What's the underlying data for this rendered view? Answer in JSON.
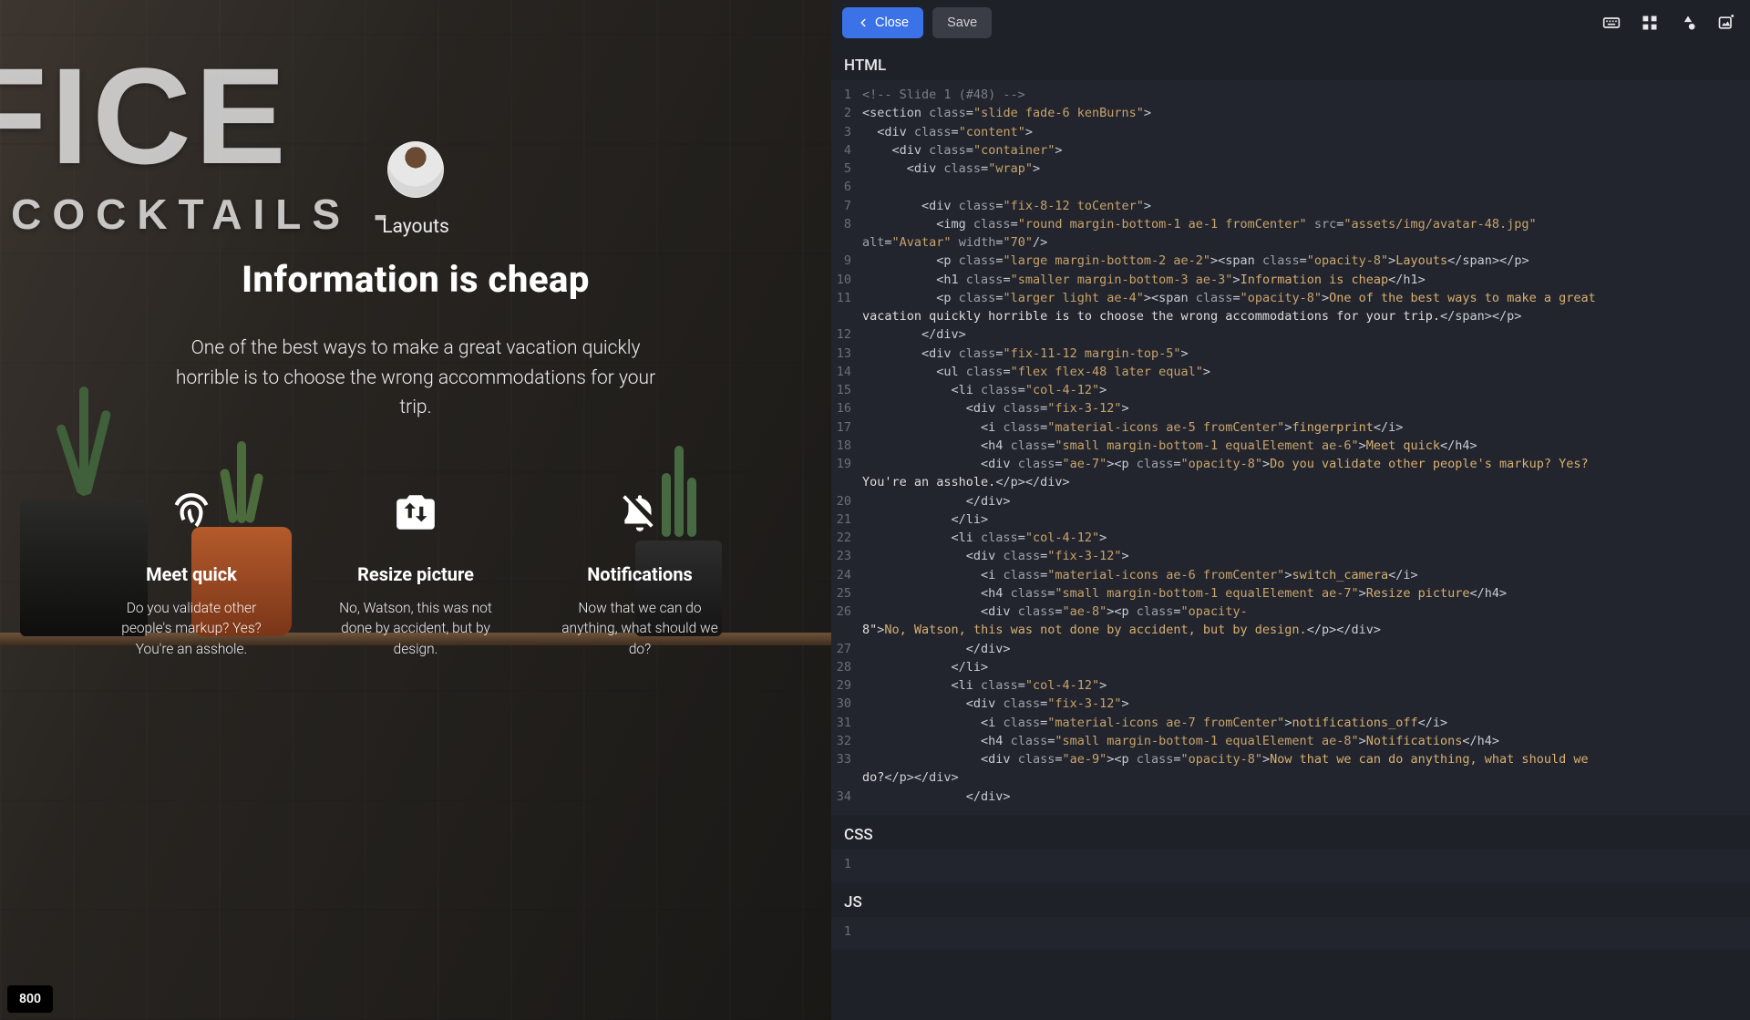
{
  "toolbar": {
    "close_label": "Close",
    "save_label": "Save"
  },
  "sections": {
    "html": "HTML",
    "css": "CSS",
    "js": "JS"
  },
  "badge": "800",
  "slide": {
    "subtitle": "Layouts",
    "title": "Information is cheap",
    "tagline": "One of the best ways to make a great vacation quickly horrible is to choose the wrong accommodations for your trip.",
    "features": [
      {
        "icon": "fingerprint",
        "heading": "Meet quick",
        "body": "Do you validate other people's markup? Yes? You're an asshole."
      },
      {
        "icon": "switch_camera",
        "heading": "Resize picture",
        "body": "No, Watson, this was not done by accident, but by design."
      },
      {
        "icon": "notifications_off",
        "heading": "Notifications",
        "body": "Now that we can do anything, what should we do?"
      }
    ]
  },
  "glass": {
    "line1": "FICE",
    "line2": "- COCKTAILS -"
  },
  "code_html": [
    {
      "n": 1,
      "seg": [
        [
          "comment",
          "<!-- Slide 1 (#48) -->"
        ]
      ]
    },
    {
      "n": 2,
      "seg": [
        [
          "tag",
          "<section "
        ],
        [
          "attr",
          "class"
        ],
        [
          "tag",
          "="
        ],
        [
          "str",
          "\"slide fade-6 kenBurns\""
        ],
        [
          "tag",
          ">"
        ]
      ]
    },
    {
      "n": 3,
      "seg": [
        [
          "tag",
          "  <div "
        ],
        [
          "attr",
          "class"
        ],
        [
          "tag",
          "="
        ],
        [
          "str",
          "\"content\""
        ],
        [
          "tag",
          ">"
        ]
      ]
    },
    {
      "n": 4,
      "seg": [
        [
          "tag",
          "    <div "
        ],
        [
          "attr",
          "class"
        ],
        [
          "tag",
          "="
        ],
        [
          "str",
          "\"container\""
        ],
        [
          "tag",
          ">"
        ]
      ]
    },
    {
      "n": 5,
      "seg": [
        [
          "tag",
          "      <div "
        ],
        [
          "attr",
          "class"
        ],
        [
          "tag",
          "="
        ],
        [
          "str",
          "\"wrap\""
        ],
        [
          "tag",
          ">"
        ]
      ]
    },
    {
      "n": 6,
      "seg": [
        [
          "tag",
          ""
        ]
      ]
    },
    {
      "n": 7,
      "seg": [
        [
          "tag",
          "        <div "
        ],
        [
          "attr",
          "class"
        ],
        [
          "tag",
          "="
        ],
        [
          "str",
          "\"fix-8-12 toCenter\""
        ],
        [
          "tag",
          ">"
        ]
      ]
    },
    {
      "n": 8,
      "seg": [
        [
          "tag",
          "          <img "
        ],
        [
          "attr",
          "class"
        ],
        [
          "tag",
          "="
        ],
        [
          "str",
          "\"round margin-bottom-1 ae-1 fromCenter\""
        ],
        [
          "tag",
          " "
        ],
        [
          "attr",
          "src"
        ],
        [
          "tag",
          "="
        ],
        [
          "str",
          "\"assets/img/avatar-48.jpg\""
        ],
        [
          "tag",
          " \n"
        ],
        [
          "attr",
          "alt"
        ],
        [
          "tag",
          "="
        ],
        [
          "str",
          "\"Avatar\""
        ],
        [
          "tag",
          " "
        ],
        [
          "attr",
          "width"
        ],
        [
          "tag",
          "="
        ],
        [
          "str",
          "\"70\""
        ],
        [
          "tag",
          "/>"
        ]
      ]
    },
    {
      "n": 9,
      "seg": [
        [
          "tag",
          "          <p "
        ],
        [
          "attr",
          "class"
        ],
        [
          "tag",
          "="
        ],
        [
          "str",
          "\"large margin-bottom-2 ae-2\""
        ],
        [
          "tag",
          "><span "
        ],
        [
          "attr",
          "class"
        ],
        [
          "tag",
          "="
        ],
        [
          "str",
          "\"opacity-8\""
        ],
        [
          "tag",
          ">"
        ],
        [
          "txt",
          "Layouts"
        ],
        [
          "tag",
          "</span></p>"
        ]
      ]
    },
    {
      "n": 10,
      "seg": [
        [
          "tag",
          "          <h1 "
        ],
        [
          "attr",
          "class"
        ],
        [
          "tag",
          "="
        ],
        [
          "str",
          "\"smaller margin-bottom-3 ae-3\""
        ],
        [
          "tag",
          ">"
        ],
        [
          "txt",
          "Information is cheap"
        ],
        [
          "tag",
          "</h1>"
        ]
      ]
    },
    {
      "n": 11,
      "seg": [
        [
          "tag",
          "          <p "
        ],
        [
          "attr",
          "class"
        ],
        [
          "tag",
          "="
        ],
        [
          "str",
          "\"larger light ae-4\""
        ],
        [
          "tag",
          "><span "
        ],
        [
          "attr",
          "class"
        ],
        [
          "tag",
          "="
        ],
        [
          "str",
          "\"opacity-8\""
        ],
        [
          "tag",
          ">"
        ],
        [
          "txt",
          "One of the best ways to make a great \nvacation quickly horrible is to choose the wrong accommodations for your&nbsp;trip."
        ],
        [
          "tag",
          "</span></p>"
        ]
      ]
    },
    {
      "n": 12,
      "seg": [
        [
          "tag",
          "        </div>"
        ]
      ]
    },
    {
      "n": 13,
      "seg": [
        [
          "tag",
          "        <div "
        ],
        [
          "attr",
          "class"
        ],
        [
          "tag",
          "="
        ],
        [
          "str",
          "\"fix-11-12 margin-top-5\""
        ],
        [
          "tag",
          ">"
        ]
      ]
    },
    {
      "n": 14,
      "seg": [
        [
          "tag",
          "          <ul "
        ],
        [
          "attr",
          "class"
        ],
        [
          "tag",
          "="
        ],
        [
          "str",
          "\"flex flex-48 later equal\""
        ],
        [
          "tag",
          ">"
        ]
      ]
    },
    {
      "n": 15,
      "seg": [
        [
          "tag",
          "            <li "
        ],
        [
          "attr",
          "class"
        ],
        [
          "tag",
          "="
        ],
        [
          "str",
          "\"col-4-12\""
        ],
        [
          "tag",
          ">"
        ]
      ]
    },
    {
      "n": 16,
      "seg": [
        [
          "tag",
          "              <div "
        ],
        [
          "attr",
          "class"
        ],
        [
          "tag",
          "="
        ],
        [
          "str",
          "\"fix-3-12\""
        ],
        [
          "tag",
          ">"
        ]
      ]
    },
    {
      "n": 17,
      "seg": [
        [
          "tag",
          "                <i "
        ],
        [
          "attr",
          "class"
        ],
        [
          "tag",
          "="
        ],
        [
          "str",
          "\"material-icons ae-5 fromCenter\""
        ],
        [
          "tag",
          ">"
        ],
        [
          "txt",
          "fingerprint"
        ],
        [
          "tag",
          "</i>"
        ]
      ]
    },
    {
      "n": 18,
      "seg": [
        [
          "tag",
          "                <h4 "
        ],
        [
          "attr",
          "class"
        ],
        [
          "tag",
          "="
        ],
        [
          "str",
          "\"small margin-bottom-1 equalElement ae-6\""
        ],
        [
          "tag",
          ">"
        ],
        [
          "txt",
          "Meet quick"
        ],
        [
          "tag",
          "</h4>"
        ]
      ]
    },
    {
      "n": 19,
      "seg": [
        [
          "tag",
          "                <div "
        ],
        [
          "attr",
          "class"
        ],
        [
          "tag",
          "="
        ],
        [
          "str",
          "\"ae-7\""
        ],
        [
          "tag",
          "><p "
        ],
        [
          "attr",
          "class"
        ],
        [
          "tag",
          "="
        ],
        [
          "str",
          "\"opacity-8\""
        ],
        [
          "tag",
          ">"
        ],
        [
          "txt",
          "Do you validate other people's markup? Yes? \nYou're an asshole."
        ],
        [
          "tag",
          "</p></div>"
        ]
      ]
    },
    {
      "n": 20,
      "seg": [
        [
          "tag",
          "              </div>"
        ]
      ]
    },
    {
      "n": 21,
      "seg": [
        [
          "tag",
          "            </li>"
        ]
      ]
    },
    {
      "n": 22,
      "seg": [
        [
          "tag",
          "            <li "
        ],
        [
          "attr",
          "class"
        ],
        [
          "tag",
          "="
        ],
        [
          "str",
          "\"col-4-12\""
        ],
        [
          "tag",
          ">"
        ]
      ]
    },
    {
      "n": 23,
      "seg": [
        [
          "tag",
          "              <div "
        ],
        [
          "attr",
          "class"
        ],
        [
          "tag",
          "="
        ],
        [
          "str",
          "\"fix-3-12\""
        ],
        [
          "tag",
          ">"
        ]
      ]
    },
    {
      "n": 24,
      "seg": [
        [
          "tag",
          "                <i "
        ],
        [
          "attr",
          "class"
        ],
        [
          "tag",
          "="
        ],
        [
          "str",
          "\"material-icons ae-6 fromCenter\""
        ],
        [
          "tag",
          ">"
        ],
        [
          "txt",
          "switch_camera"
        ],
        [
          "tag",
          "</i>"
        ]
      ]
    },
    {
      "n": 25,
      "seg": [
        [
          "tag",
          "                <h4 "
        ],
        [
          "attr",
          "class"
        ],
        [
          "tag",
          "="
        ],
        [
          "str",
          "\"small margin-bottom-1 equalElement ae-7\""
        ],
        [
          "tag",
          ">"
        ],
        [
          "txt",
          "Resize picture"
        ],
        [
          "tag",
          "</h4>"
        ]
      ]
    },
    {
      "n": 26,
      "seg": [
        [
          "tag",
          "                <div "
        ],
        [
          "attr",
          "class"
        ],
        [
          "tag",
          "="
        ],
        [
          "str",
          "\"ae-8\""
        ],
        [
          "tag",
          "><p "
        ],
        [
          "attr",
          "class"
        ],
        [
          "tag",
          "="
        ],
        [
          "str",
          "\"opacity-\n8\""
        ],
        [
          "tag",
          ">"
        ],
        [
          "txt",
          "No, Watson, this was not done by accident, but by design."
        ],
        [
          "tag",
          "</p></div>"
        ]
      ]
    },
    {
      "n": 27,
      "seg": [
        [
          "tag",
          "              </div>"
        ]
      ]
    },
    {
      "n": 28,
      "seg": [
        [
          "tag",
          "            </li>"
        ]
      ]
    },
    {
      "n": 29,
      "seg": [
        [
          "tag",
          "            <li "
        ],
        [
          "attr",
          "class"
        ],
        [
          "tag",
          "="
        ],
        [
          "str",
          "\"col-4-12\""
        ],
        [
          "tag",
          ">"
        ]
      ]
    },
    {
      "n": 30,
      "seg": [
        [
          "tag",
          "              <div "
        ],
        [
          "attr",
          "class"
        ],
        [
          "tag",
          "="
        ],
        [
          "str",
          "\"fix-3-12\""
        ],
        [
          "tag",
          ">"
        ]
      ]
    },
    {
      "n": 31,
      "seg": [
        [
          "tag",
          "                <i "
        ],
        [
          "attr",
          "class"
        ],
        [
          "tag",
          "="
        ],
        [
          "str",
          "\"material-icons ae-7 fromCenter\""
        ],
        [
          "tag",
          ">"
        ],
        [
          "txt",
          "notifications_off"
        ],
        [
          "tag",
          "</i>"
        ]
      ]
    },
    {
      "n": 32,
      "seg": [
        [
          "tag",
          "                <h4 "
        ],
        [
          "attr",
          "class"
        ],
        [
          "tag",
          "="
        ],
        [
          "str",
          "\"small margin-bottom-1 equalElement ae-8\""
        ],
        [
          "tag",
          ">"
        ],
        [
          "txt",
          "Notifications"
        ],
        [
          "tag",
          "</h4>"
        ]
      ]
    },
    {
      "n": 33,
      "seg": [
        [
          "tag",
          "                <div "
        ],
        [
          "attr",
          "class"
        ],
        [
          "tag",
          "="
        ],
        [
          "str",
          "\"ae-9\""
        ],
        [
          "tag",
          "><p "
        ],
        [
          "attr",
          "class"
        ],
        [
          "tag",
          "="
        ],
        [
          "str",
          "\"opacity-8\""
        ],
        [
          "tag",
          ">"
        ],
        [
          "txt",
          "Now that we can do anything, what should we \ndo?"
        ],
        [
          "tag",
          "</p></div>"
        ]
      ]
    },
    {
      "n": 34,
      "seg": [
        [
          "tag",
          "              </div>"
        ]
      ]
    }
  ],
  "code_css": [
    {
      "n": 1,
      "seg": [
        [
          "tag",
          ""
        ]
      ]
    }
  ],
  "code_js": [
    {
      "n": 1,
      "seg": [
        [
          "tag",
          ""
        ]
      ]
    }
  ]
}
